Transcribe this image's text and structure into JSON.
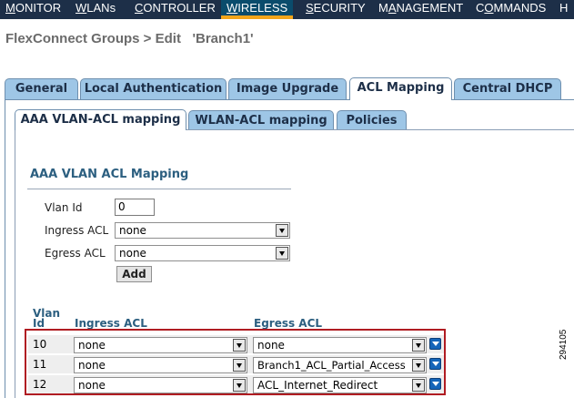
{
  "nav": {
    "items": [
      {
        "pre": "",
        "u": "M",
        "post": "ONITOR"
      },
      {
        "pre": "",
        "u": "W",
        "post": "LANs"
      },
      {
        "pre": "",
        "u": "C",
        "post": "ONTROLLER"
      },
      {
        "pre": "",
        "u": "W",
        "post": "IRELESS"
      },
      {
        "pre": "",
        "u": "S",
        "post": "ECURITY"
      },
      {
        "pre": "M",
        "u": "A",
        "post": "NAGEMENT"
      },
      {
        "pre": "C",
        "u": "O",
        "post": "MMANDS"
      },
      {
        "pre": "",
        "u": "",
        "post": "H"
      }
    ],
    "active_index": 3
  },
  "page_title": "FlexConnect Groups > Edit   'Branch1'",
  "tabs": [
    {
      "label": "General"
    },
    {
      "label": "Local Authentication"
    },
    {
      "label": "Image Upgrade"
    },
    {
      "label": "ACL Mapping"
    },
    {
      "label": "Central DHCP"
    }
  ],
  "active_tab": "ACL Mapping",
  "subtabs": [
    {
      "label": "AAA VLAN-ACL mapping"
    },
    {
      "label": "WLAN-ACL mapping"
    },
    {
      "label": "Policies"
    }
  ],
  "active_subtab": "AAA VLAN-ACL mapping",
  "form": {
    "title": "AAA VLAN ACL Mapping",
    "vlan_id_label": "Vlan Id",
    "vlan_id_value": "0",
    "ingress_label": "Ingress ACL",
    "ingress_value": "none",
    "egress_label": "Egress ACL",
    "egress_value": "none",
    "add_label": "Add"
  },
  "table": {
    "headers": {
      "vlan_line1": "Vlan",
      "vlan_line2": "Id",
      "ingress": "Ingress ACL",
      "egress": "Egress ACL"
    },
    "rows": [
      {
        "vlan": "10",
        "ingress": "none",
        "egress": "none"
      },
      {
        "vlan": "11",
        "ingress": "none",
        "egress": "Branch1_ACL_Partial_Access"
      },
      {
        "vlan": "12",
        "ingress": "none",
        "egress": "ACL_Internet_Redirect"
      }
    ]
  },
  "figure_number": "294105",
  "colors": {
    "nav_bg": "#1d2f48",
    "tab_bg": "#9ec6e6",
    "highlight": "#b01c22",
    "heading": "#2c5f80"
  }
}
